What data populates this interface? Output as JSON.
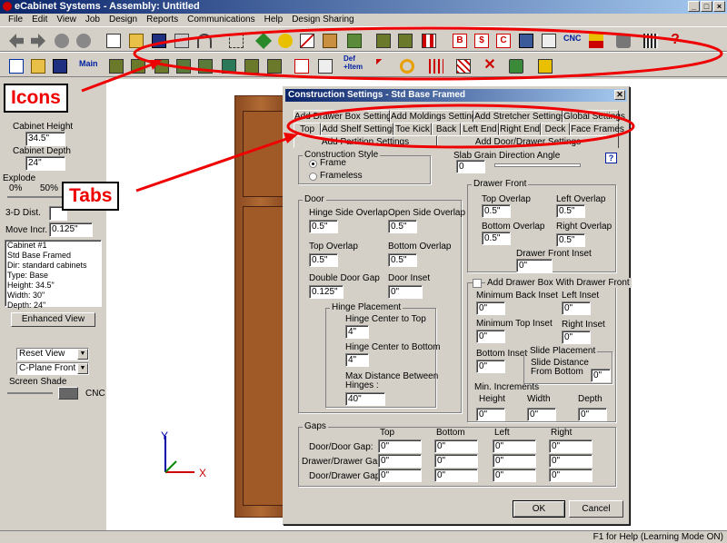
{
  "window": {
    "title": "eCabinet Systems - Assembly: Untitled"
  },
  "menu": [
    "File",
    "Edit",
    "View",
    "Job",
    "Design",
    "Reports",
    "Communications",
    "Help",
    "Design Sharing"
  ],
  "toolbar": {
    "cnc_label": "CNC",
    "main_label": "Main",
    "def_label": "Def",
    "item_label": "+Item"
  },
  "left": {
    "cabinet_height_label": "Cabinet Height",
    "cabinet_height": "34.5\"",
    "cabinet_depth_label": "Cabinet Depth",
    "cabinet_depth": "24\"",
    "explode_label": "Explode",
    "explode_min": "0%",
    "explode_max": "50%",
    "dist_label": "3-D Dist.",
    "move_incr_label": "Move Incr.",
    "move_incr": "0.125\"",
    "info": [
      "Cabinet #1",
      "Std Base Framed",
      "Dir: standard cabinets",
      "Type: Base",
      "Height: 34.5\"",
      "Width: 30\"",
      "Depth: 24\""
    ],
    "enhanced_view": "Enhanced View",
    "reset_view": "Reset View",
    "cplane": "C-Plane Front",
    "screen_shade": "Screen Shade",
    "cnc": "CNC"
  },
  "axes": {
    "y": "Y",
    "x": "X"
  },
  "annotations": {
    "icons": "Icons",
    "tabs": "Tabs"
  },
  "dialog": {
    "title": "Construction Settings - Std Base Framed",
    "tabs_row1": [
      "Add Drawer Box Settings",
      "Add Moldings Settings",
      "Add Stretcher Settings",
      "Global Settings"
    ],
    "tabs_row2": [
      "Top",
      "Add Shelf Settings",
      "Toe Kick",
      "Back",
      "Left End",
      "Right End",
      "Deck",
      "Face Frames"
    ],
    "tabs_row3": [
      "Add Partition Settings",
      "Add Door/Drawer Settings"
    ],
    "construction_style": {
      "label": "Construction Style",
      "frame": "Frame",
      "frameless": "Frameless"
    },
    "slab_grain": {
      "label": "Slab Grain Direction Angle",
      "value": "0"
    },
    "help": "?",
    "door": {
      "label": "Door",
      "hinge_side_overlap_label": "Hinge Side Overlap",
      "hinge_side_overlap": "0.5\"",
      "open_side_overlap_label": "Open Side Overlap",
      "open_side_overlap": "0.5\"",
      "top_overlap_label": "Top Overlap",
      "top_overlap": "0.5\"",
      "bottom_overlap_label": "Bottom Overlap",
      "bottom_overlap": "0.5\"",
      "double_door_gap_label": "Double Door Gap",
      "double_door_gap": "0.125\"",
      "door_inset_label": "Door Inset",
      "door_inset": "0\""
    },
    "hinge": {
      "label": "Hinge Placement",
      "center_top_label": "Hinge Center to Top",
      "center_top": "4\"",
      "center_bottom_label": "Hinge Center to Bottom",
      "center_bottom": "4\"",
      "max_distance_label_1": "Max Distance Between",
      "max_distance_label_2": "Hinges :",
      "max_distance": "40\""
    },
    "drawer_front": {
      "label": "Drawer Front",
      "top_overlap_label": "Top Overlap",
      "top_overlap": "0.5\"",
      "left_overlap_label": "Left Overlap",
      "left_overlap": "0.5\"",
      "bottom_overlap_label": "Bottom Overlap",
      "bottom_overlap": "0.5\"",
      "right_overlap_label": "Right Overlap",
      "right_overlap": "0.5\"",
      "inset_label": "Drawer Front Inset",
      "inset": "0\""
    },
    "drawer_box": {
      "label": "Add Drawer Box With Drawer Front",
      "min_back_inset_label": "Minimum Back Inset",
      "min_back_inset": "0\"",
      "left_inset_label": "Left Inset",
      "left_inset": "0\"",
      "min_top_inset_label": "Minimum Top Inset",
      "min_top_inset": "0\"",
      "right_inset_label": "Right Inset",
      "right_inset": "0\"",
      "bottom_inset_label": "Bottom Inset",
      "bottom_inset": "0\"",
      "slide_placement_label": "Slide Placement",
      "slide_distance_label_1": "Slide Distance",
      "slide_distance_label_2": "From Bottom",
      "slide_distance": "0\"",
      "min_increments_label": "Min. Increments",
      "height_label": "Height",
      "height": "0\"",
      "width_label": "Width",
      "width": "0\"",
      "depth_label": "Depth",
      "depth": "0\""
    },
    "gaps": {
      "label": "Gaps",
      "columns": [
        "Top",
        "Bottom",
        "Left",
        "Right"
      ],
      "rows": [
        {
          "label": "Door/Door Gap:",
          "values": [
            "0\"",
            "0\"",
            "0\"",
            "0\""
          ]
        },
        {
          "label": "Drawer/Drawer Gap:",
          "values": [
            "0\"",
            "0\"",
            "0\"",
            "0\""
          ]
        },
        {
          "label": "Door/Drawer Gap:",
          "values": [
            "0\"",
            "0\"",
            "0\"",
            "0\""
          ]
        }
      ]
    },
    "ok": "OK",
    "cancel": "Cancel"
  },
  "status": "F1 for Help (Learning Mode ON)"
}
